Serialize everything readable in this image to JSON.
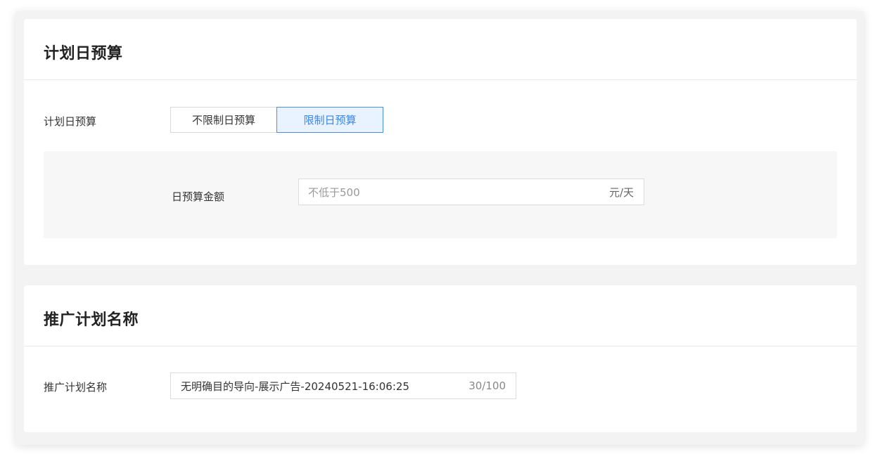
{
  "daily_budget_card": {
    "title": "计划日预算",
    "field_label": "计划日预算",
    "options": [
      {
        "label": "不限制日预算",
        "selected": false
      },
      {
        "label": "限制日预算",
        "selected": true
      }
    ],
    "amount": {
      "label": "日预算金额",
      "placeholder": "不低于500",
      "unit": "元/天"
    }
  },
  "plan_name_card": {
    "title": "推广计划名称",
    "field_label": "推广计划名称",
    "value": "无明确目的导向-展示广告-20240521-16:06:25",
    "char_count": "30/100"
  },
  "colors": {
    "accent": "#3a86f0",
    "accent_bg": "#e8f3ff",
    "panel_bg": "#f7f7f7"
  }
}
